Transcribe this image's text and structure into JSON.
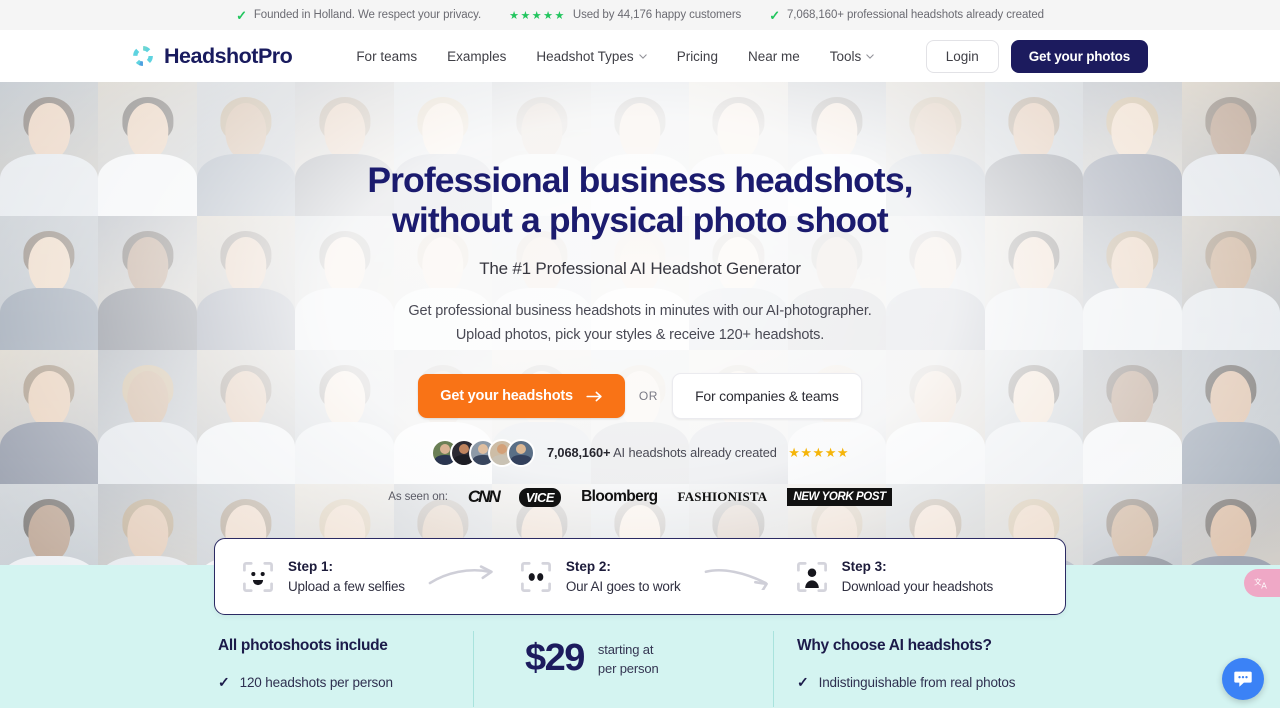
{
  "topbar": {
    "items": [
      {
        "icon": "check-icon",
        "text": "Founded in Holland. We respect your privacy."
      },
      {
        "icon": "stars-icon",
        "stars": "★★★★★",
        "text": "Used by 44,176 happy customers"
      },
      {
        "icon": "check-icon",
        "text": "7,068,160+ professional headshots already created"
      }
    ]
  },
  "header": {
    "brand": "HeadshotPro",
    "nav": [
      {
        "label": "For teams",
        "has_dropdown": false
      },
      {
        "label": "Examples",
        "has_dropdown": false
      },
      {
        "label": "Headshot Types",
        "has_dropdown": true
      },
      {
        "label": "Pricing",
        "has_dropdown": false
      },
      {
        "label": "Near me",
        "has_dropdown": false
      },
      {
        "label": "Tools",
        "has_dropdown": true
      }
    ],
    "login_label": "Login",
    "cta_label": "Get your photos"
  },
  "hero": {
    "headline_line1": "Professional business headshots,",
    "headline_line2": "without a physical photo shoot",
    "subhead": "The #1 Professional AI Headshot Generator",
    "description": "Get professional business headshots in minutes with our AI-photographer. Upload photos, pick your styles & receive 120+ headshots.",
    "primary_cta": "Get your headshots",
    "or_label": "OR",
    "secondary_cta": "For companies & teams",
    "social_count": "7,068,160+",
    "social_text": " AI headshots already created",
    "social_stars": "★★★★★",
    "press_label": "As seen on:",
    "press_logos": [
      "CNN",
      "VICE",
      "Bloomberg",
      "FASHIONISTA",
      "NEW YORK POST"
    ]
  },
  "steps": [
    {
      "title": "Step 1:",
      "subtitle": "Upload a few selfies",
      "icon": "face-scan-smile-icon"
    },
    {
      "title": "Step 2:",
      "subtitle": "Our AI goes to work",
      "icon": "face-scan-eyes-icon"
    },
    {
      "title": "Step 3:",
      "subtitle": "Download your headshots",
      "icon": "face-scan-person-icon"
    }
  ],
  "band": {
    "include_title": "All photoshoots include",
    "include_item": "120 headshots per person",
    "price": "$29",
    "price_note_line1": "starting at",
    "price_note_line2": "per person",
    "why_title": "Why choose AI headshots?",
    "why_item": "Indistinguishable from real photos"
  },
  "widgets": {
    "translate": "translate-language-icon",
    "chat": "chat-bubble-icon"
  },
  "colors": {
    "brand_navy": "#1c1b5e",
    "accent_orange": "#f97316",
    "band_teal": "#d4f4f1",
    "green_tick": "#22c55e",
    "star_gold": "#f5b50a",
    "chat_blue": "#3b82f6",
    "translate_pink": "#efa8c6"
  }
}
